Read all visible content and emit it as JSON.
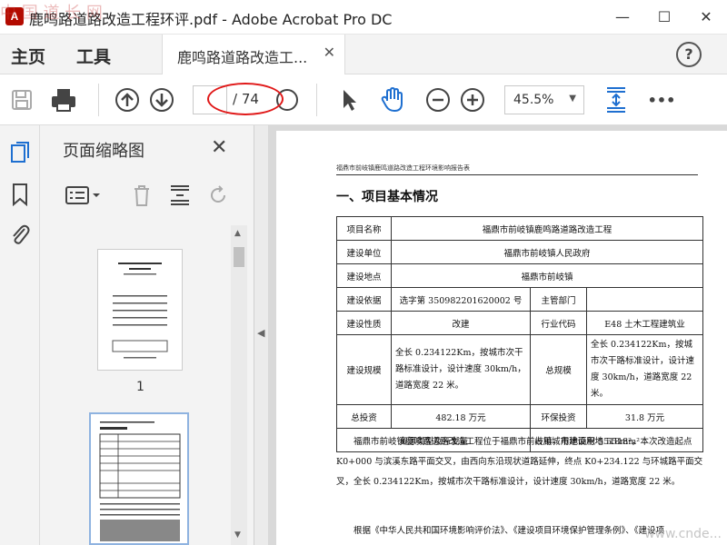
{
  "window": {
    "title": "鹿鸣路道路改造工程环评.pdf - Adobe Acrobat Pro DC",
    "app_icon_label": "A",
    "watermark": "中 国 道 长 网",
    "controls": {
      "minimize": "—",
      "maximize": "☐",
      "close": "✕"
    }
  },
  "tabs": {
    "home": "主页",
    "tools": "工具",
    "document": "鹿鸣路道路改造工...",
    "help": "?"
  },
  "toolbar": {
    "page_current": "",
    "page_total": "/ 74",
    "zoom": "45.5%",
    "more": "•••"
  },
  "thumbnails_pane": {
    "title": "页面缩略图",
    "page1_label": "1",
    "close": "✕"
  },
  "document": {
    "running_header": "福鼎市前岐镇鹿鸣道路改造工程环境影响报告表",
    "section_title": "一、项目基本情况",
    "table": {
      "project_name_label": "项目名称",
      "project_name": "福鼎市前岐镇鹿鸣路道路改造工程",
      "unit_label": "建设单位",
      "unit": "福鼎市前岐镇人民政府",
      "location_label": "建设地点",
      "location": "福鼎市前岐镇",
      "basis_label": "建设依据",
      "basis": "选字第 350982201620002 号",
      "authority_label": "主管部门",
      "authority": "",
      "nature_label": "建设性质",
      "nature": "改建",
      "industry_label": "行业代码",
      "industry": "E48 土木工程建筑业",
      "scale_label": "建设规模",
      "scale": "全长 0.234122Km，按城市次干路标准设计，设计速度 30km/h，道路宽度 22 米。",
      "total_scale_label": "总规模",
      "total_scale": "全长 0.234122Km，按城市次干路标准设计，设计速度 30km/h，道路宽度 22 米。",
      "investment_label": "总投资",
      "investment": "482.18 万元",
      "env_investment_label": "环保投资",
      "env_investment": "31.8 万元",
      "resource_label": "资源类型及开发量",
      "resource": "占用城市建设用地 5518m²"
    },
    "paragraph1": "福鼎市前岐镇鹿鸣路道路改造工程位于福鼎市前岐镇，用地面积 5518m²，本次改造起点 K0+000 与滨溪东路平面交叉，由西向东沿现状道路延伸，终点 K0+234.122 与环城路平面交叉，全长 0.234122Km，按城市次干路标准设计，设计速度 30km/h，道路宽度 22 米。",
    "paragraph2": "根据《中华人民共和国环境影响评价法》、《建设项目环境保护管理条例》、《建设项",
    "site_watermark": "www.cnde..."
  }
}
